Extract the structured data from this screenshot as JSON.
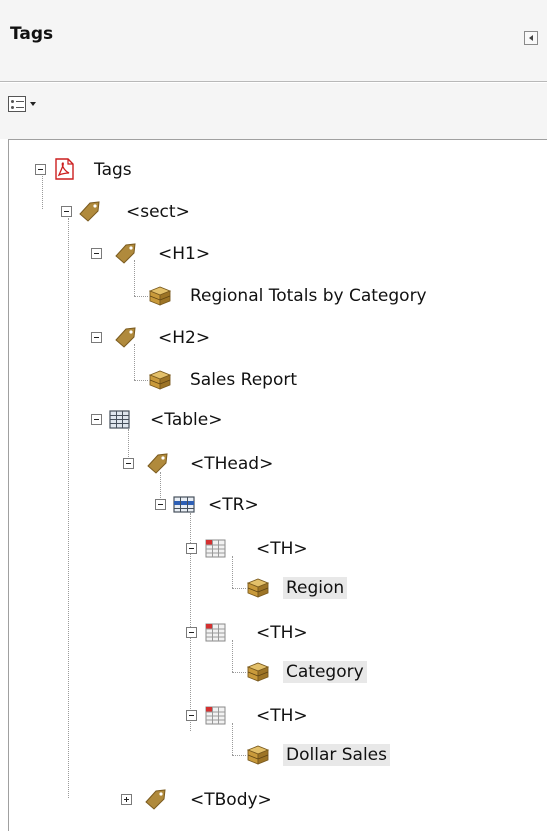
{
  "panel": {
    "title": "Tags"
  },
  "toolbar": {
    "options_icon": "options-menu-icon"
  },
  "tree": [
    {
      "label": "Tags",
      "icon": "pdf-document-icon",
      "toggle": "minus"
    },
    {
      "label": "<sect>",
      "icon": "tag-icon",
      "toggle": "minus"
    },
    {
      "label": "<H1>",
      "icon": "tag-icon",
      "toggle": "minus"
    },
    {
      "label": "Regional Totals by Category",
      "icon": "content-box-icon"
    },
    {
      "label": "<H2>",
      "icon": "tag-icon",
      "toggle": "minus"
    },
    {
      "label": "Sales Report",
      "icon": "content-box-icon"
    },
    {
      "label": "<Table>",
      "icon": "table-icon",
      "toggle": "minus"
    },
    {
      "label": "<THead>",
      "icon": "tag-icon",
      "toggle": "minus"
    },
    {
      "label": "<TR>",
      "icon": "table-row-icon",
      "toggle": "minus"
    },
    {
      "label": "<TH>",
      "icon": "table-header-cell-icon",
      "toggle": "minus"
    },
    {
      "label": "Region",
      "icon": "content-box-icon"
    },
    {
      "label": "<TH>",
      "icon": "table-header-cell-icon",
      "toggle": "minus"
    },
    {
      "label": "Category",
      "icon": "content-box-icon"
    },
    {
      "label": "<TH>",
      "icon": "table-header-cell-icon",
      "toggle": "minus"
    },
    {
      "label": "Dollar Sales",
      "icon": "content-box-icon"
    },
    {
      "label": "<TBody>",
      "icon": "tag-icon",
      "toggle": "plus"
    }
  ]
}
